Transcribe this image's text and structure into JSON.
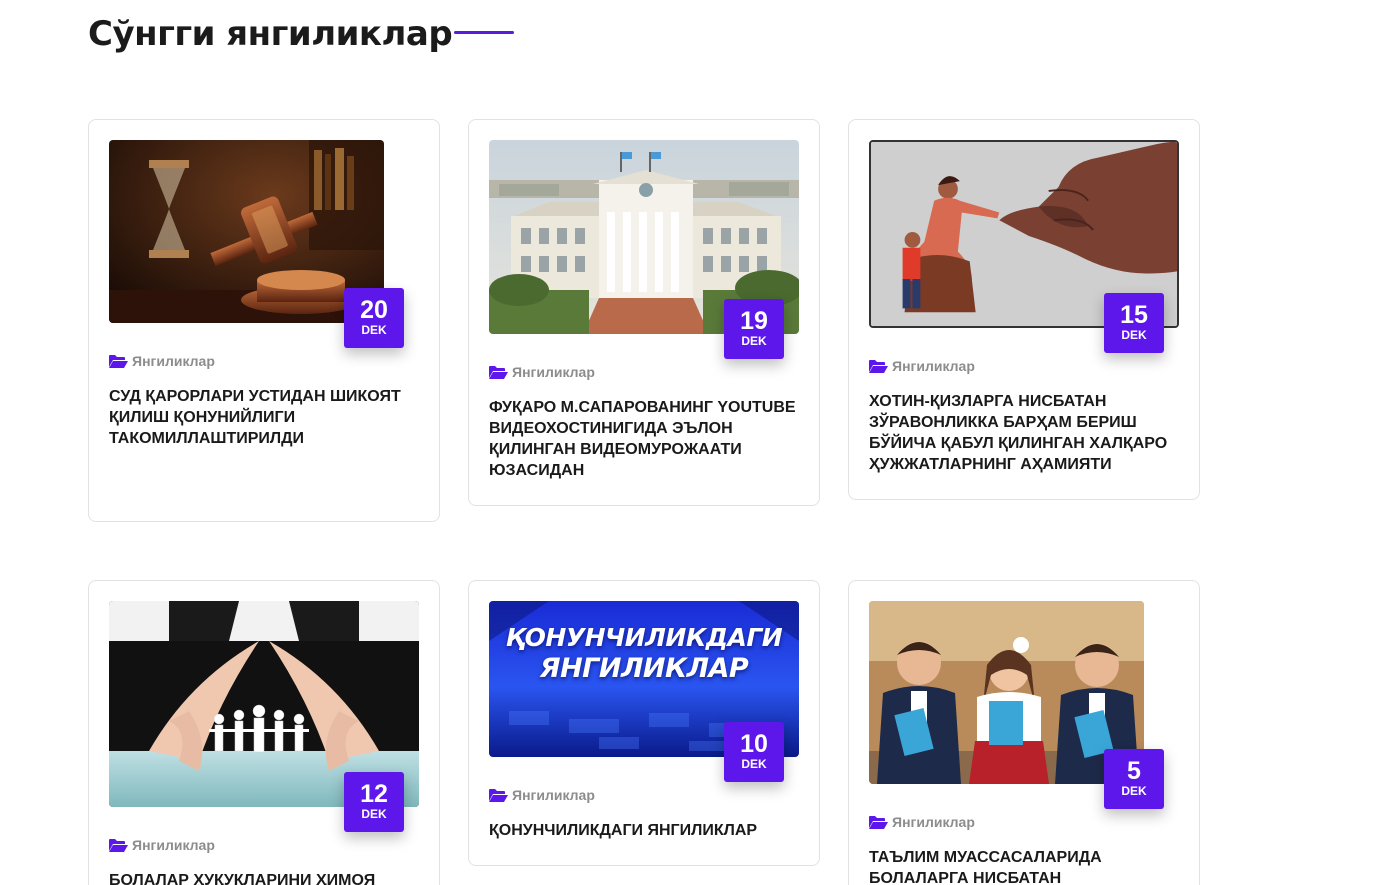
{
  "section": {
    "title": "Сўнгги янгиликлар"
  },
  "colors": {
    "accent": "#5e17eb",
    "title_line": "#5a1be0",
    "category_text": "#8c8c8c"
  },
  "news": [
    {
      "day": "20",
      "month": "DEK",
      "category": "Янгиликлар",
      "category_icon": "folder-open-icon",
      "title": "СУД ҚАРОРЛАРИ УСТИДАН ШИКОЯТ ҚИЛИШ ҚОНУНИЙЛИГИ ТАКОМИЛЛАШТИРИЛДИ",
      "image": "judge-gavel-image"
    },
    {
      "day": "19",
      "month": "DEK",
      "category": "Янгиликлар",
      "category_icon": "folder-open-icon",
      "title": "ФУҚАРО М.САПАРОВАНИНГ YOUTUBE ВИДЕОХОСТИНИГИДА ЭЪЛОН ҚИЛИНГАН ВИДЕОМУРОЖААТИ ЮЗАСИДАН",
      "image": "government-building-image"
    },
    {
      "day": "15",
      "month": "DEK",
      "category": "Янгиликлар",
      "category_icon": "folder-open-icon",
      "title": "ХОТИН-ҚИЗЛАРГА НИСБАТАН ЗЎРАВОНЛИККА БАРҲАМ БЕРИШ БЎЙИЧА ҚАБУЛ ҚИЛИНГАН ХАЛҚАРО ҲУЖЖАТЛАРНИНГ АҲАМИЯТИ",
      "image": "fist-woman-child-image"
    },
    {
      "day": "12",
      "month": "DEK",
      "category": "Янгиликлар",
      "category_icon": "folder-open-icon",
      "title": "БОЛАЛАР ҲУҚУҚЛАРИНИ ҲИМОЯ",
      "image": "protecting-hands-image"
    },
    {
      "day": "10",
      "month": "DEK",
      "category": "Янгиликлар",
      "category_icon": "folder-open-icon",
      "title": "ҚОНУНЧИЛИКДАГИ ЯНГИЛИКЛАР",
      "image": "legislation-news-banner-image",
      "banner_line1": "ҚОНУНЧИЛИКДАГИ",
      "banner_line2": "ЯНГИЛИКЛАР"
    },
    {
      "day": "5",
      "month": "DEK",
      "category": "Янгиликлар",
      "category_icon": "folder-open-icon",
      "title": "ТАЪЛИМ МУАССАСАЛАРИДА БОЛАЛАРГА НИСБАТАН",
      "image": "school-children-image"
    }
  ]
}
